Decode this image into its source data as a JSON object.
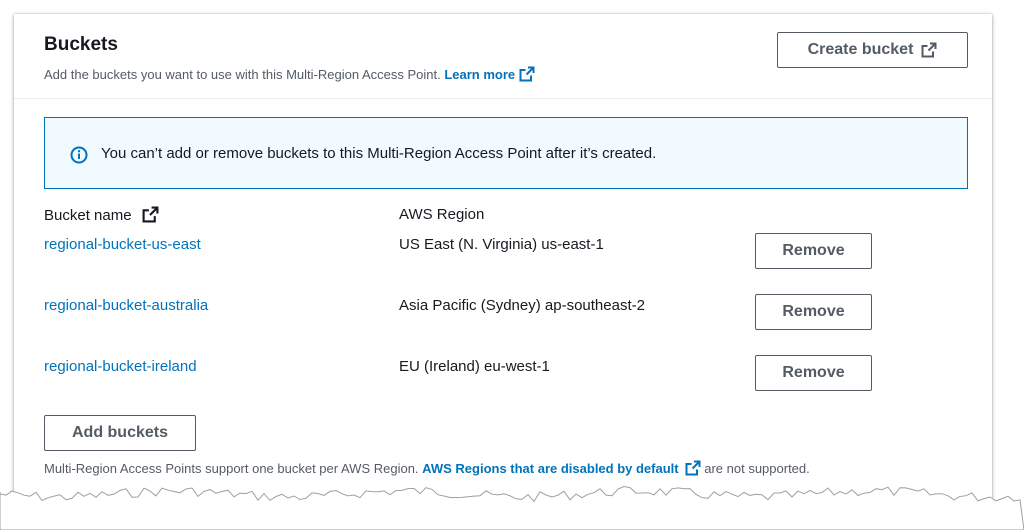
{
  "header": {
    "title": "Buckets",
    "description": "Add the buckets you want to use with this Multi-Region Access Point.",
    "learn_more": "Learn more",
    "create_button": "Create bucket"
  },
  "alert": {
    "icon": "info-icon",
    "message": "You can’t add or remove buckets to this Multi-Region Access Point after it’s created."
  },
  "table": {
    "columns": [
      "Bucket name",
      "AWS Region"
    ],
    "rows": [
      {
        "bucket": "regional-bucket-us-east",
        "region": "US East (N. Virginia) us-east-1",
        "action": "Remove"
      },
      {
        "bucket": "regional-bucket-australia",
        "region": "Asia Pacific (Sydney) ap-southeast-2",
        "action": "Remove"
      },
      {
        "bucket": "regional-bucket-ireland",
        "region": "EU (Ireland) eu-west-1",
        "action": "Remove"
      }
    ]
  },
  "add_button": "Add buckets",
  "footer": {
    "prefix": "Multi-Region Access Points support one bucket per AWS Region.",
    "link": "AWS Regions that are disabled by default",
    "suffix": "are not supported."
  },
  "colors": {
    "link": "#0073bb",
    "text": "#16191f",
    "muted": "#545b64",
    "alert_bg": "#f1faff",
    "alert_border": "#0073bb"
  }
}
